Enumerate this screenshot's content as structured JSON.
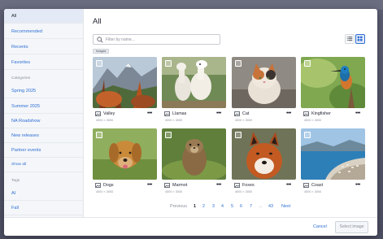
{
  "sidebar": {
    "items": [
      {
        "label": "All",
        "active": true
      },
      {
        "label": "Recommended"
      },
      {
        "label": "Recents"
      },
      {
        "label": "Favorites"
      }
    ],
    "categories_heading": "Categories",
    "categories": [
      {
        "label": "Spring 2025"
      },
      {
        "label": "Summer 2025"
      },
      {
        "label": "NA Roadshow"
      },
      {
        "label": "New releases"
      },
      {
        "label": "Partner events"
      }
    ],
    "show_all": "Show all",
    "tags_heading": "Tags",
    "tags": [
      {
        "label": "AI"
      },
      {
        "label": "Fall"
      }
    ]
  },
  "main": {
    "title": "All",
    "search": {
      "placeholder": "Filter by name..."
    },
    "type_tag": "Images",
    "cards": [
      {
        "name": "Valley",
        "dims": "4000 × 3000",
        "icon": "mountain-valley-image"
      },
      {
        "name": "Llamas",
        "dims": "4000 × 3000",
        "icon": "llamas-image"
      },
      {
        "name": "Cat",
        "dims": "4000 × 3000",
        "icon": "cat-image"
      },
      {
        "name": "Kingfisher",
        "dims": "4000 × 3000",
        "icon": "kingfisher-image"
      },
      {
        "name": "Dogs",
        "dims": "4000 × 3000",
        "icon": "dog-image"
      },
      {
        "name": "Marmot",
        "dims": "4000 × 3000",
        "icon": "marmot-image"
      },
      {
        "name": "Foxes",
        "dims": "4000 × 3000",
        "icon": "fox-image"
      },
      {
        "name": "Coast",
        "dims": "4000 × 3000",
        "icon": "coast-image"
      }
    ],
    "more_label": "•••",
    "pagination": {
      "previous": "Previous",
      "pages": [
        "1",
        "2",
        "3",
        "4",
        "5",
        "6",
        "7"
      ],
      "ellipsis": "...",
      "last": "43",
      "next": "Next",
      "current": "1"
    }
  },
  "footer": {
    "cancel": "Cancel",
    "select": "Select image"
  },
  "colors": {
    "accent": "#2f6fd6",
    "backdrop": "#54566a",
    "sidebar_bg": "#f4f6f9"
  }
}
